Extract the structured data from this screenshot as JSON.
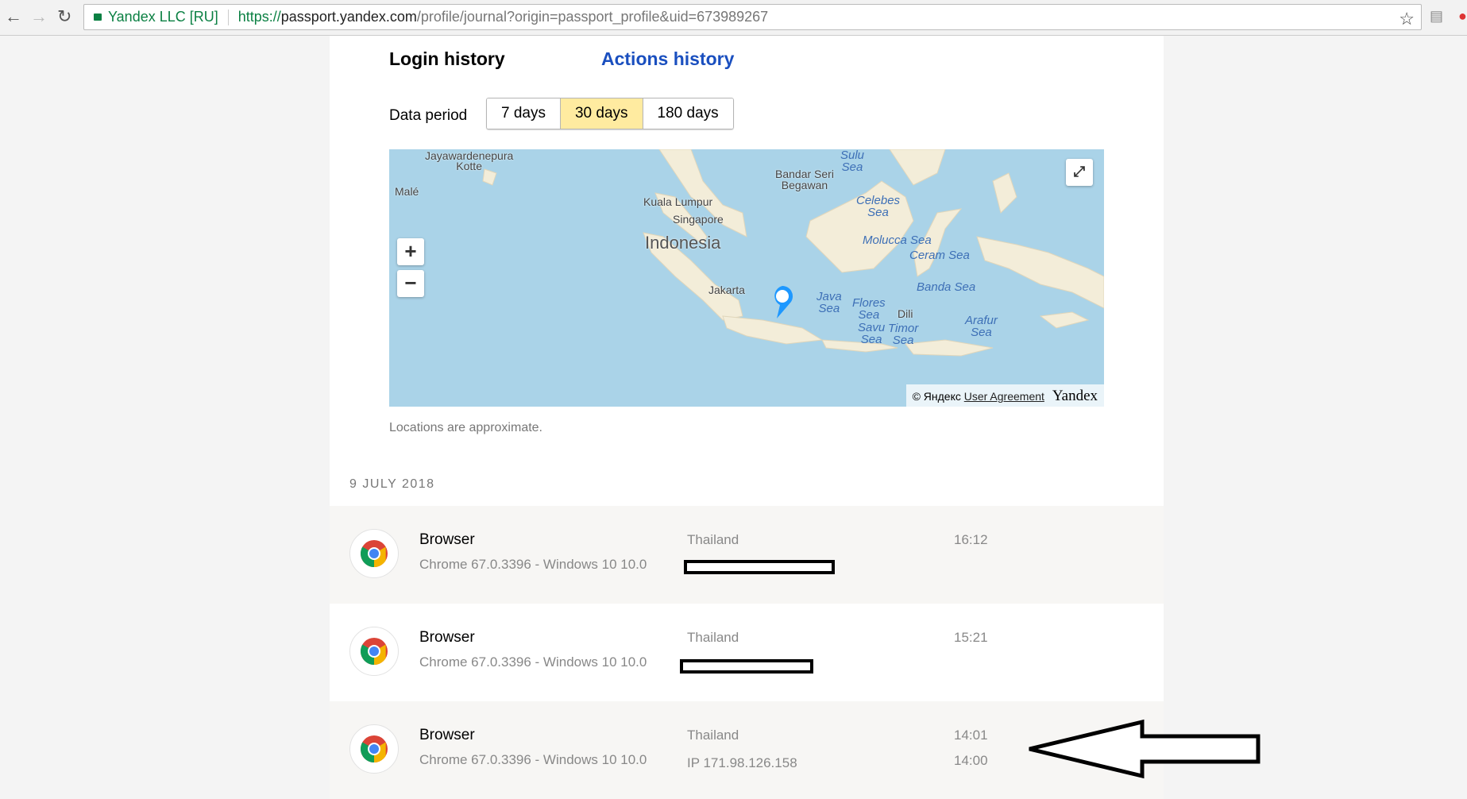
{
  "browser": {
    "security_label": "Yandex LLC [RU]",
    "url_scheme": "https://",
    "url_host": "passport.yandex.com",
    "url_path": "/profile/journal?origin=passport_profile&uid=673989267"
  },
  "tabs": {
    "login_history": "Login history",
    "actions_history": "Actions history"
  },
  "period": {
    "label": "Data period",
    "options": [
      "7 days",
      "30 days",
      "180 days"
    ],
    "selected": "30 days"
  },
  "map": {
    "labels": {
      "kotte": "Jayawardenepura\nKotte",
      "male": "Malé",
      "kl": "Kuala Lumpur",
      "singapore": "Singapore",
      "indonesia": "Indonesia",
      "jakarta": "Jakarta",
      "bandar": "Bandar Seri\nBegawan",
      "dili": "Dili"
    },
    "seas": {
      "sulu": "Sulu\nSea",
      "celebes": "Celebes\nSea",
      "molucca": "Molucca Sea",
      "ceram": "Ceram Sea",
      "banda": "Banda Sea",
      "java": "Java\nSea",
      "flores": "Flores\nSea",
      "savu": "Savu\nSea",
      "timor": "Timor\nSea",
      "arafura": "Arafur\nSea"
    },
    "copyright": "© Яндекс",
    "agreement": "User Agreement",
    "logo": "Yandex",
    "zoom_in": "+",
    "zoom_out": "−"
  },
  "note": "Locations are approximate.",
  "date_header": "9 JULY 2018",
  "entries": [
    {
      "title": "Browser",
      "detail": "Chrome 67.0.3396 - Windows 10 10.0",
      "country": "Thailand",
      "time": "16:12"
    },
    {
      "title": "Browser",
      "detail": "Chrome 67.0.3396 - Windows 10 10.0",
      "country": "Thailand",
      "time": "15:21"
    },
    {
      "title": "Browser",
      "detail": "Chrome 67.0.3396 - Windows 10 10.0",
      "country": "Thailand",
      "ip": "IP 171.98.126.158",
      "time": "14:01",
      "time2": "14:00"
    }
  ]
}
